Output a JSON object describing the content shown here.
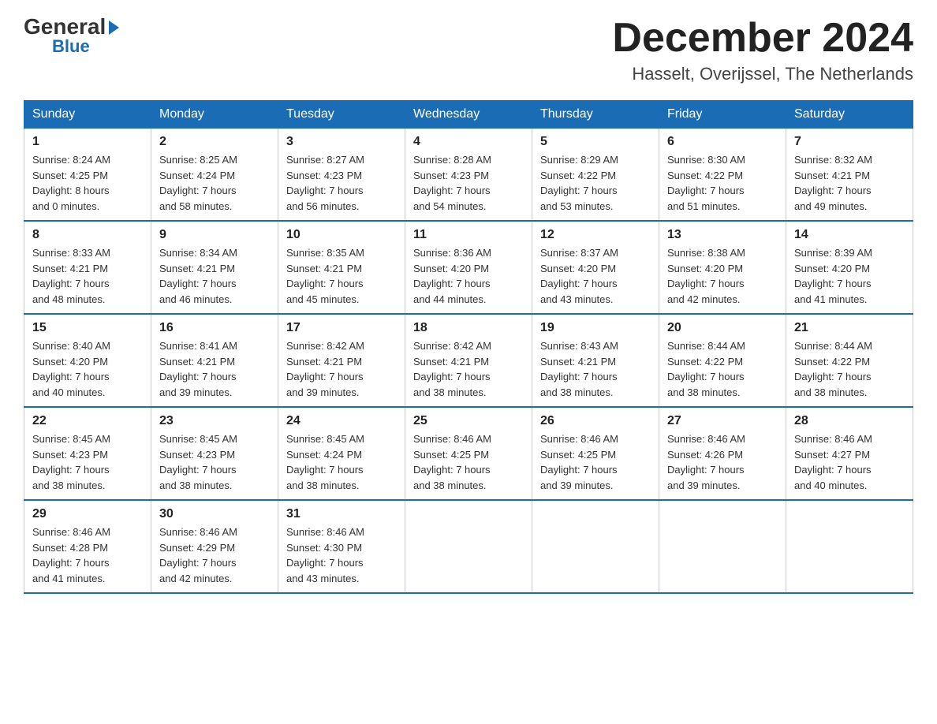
{
  "logo": {
    "general": "General",
    "arrow": "▶",
    "blue": "Blue"
  },
  "title": "December 2024",
  "location": "Hasselt, Overijssel, The Netherlands",
  "days_of_week": [
    "Sunday",
    "Monday",
    "Tuesday",
    "Wednesday",
    "Thursday",
    "Friday",
    "Saturday"
  ],
  "weeks": [
    [
      {
        "day": "1",
        "sunrise": "8:24 AM",
        "sunset": "4:25 PM",
        "daylight": "8 hours and 0 minutes."
      },
      {
        "day": "2",
        "sunrise": "8:25 AM",
        "sunset": "4:24 PM",
        "daylight": "7 hours and 58 minutes."
      },
      {
        "day": "3",
        "sunrise": "8:27 AM",
        "sunset": "4:23 PM",
        "daylight": "7 hours and 56 minutes."
      },
      {
        "day": "4",
        "sunrise": "8:28 AM",
        "sunset": "4:23 PM",
        "daylight": "7 hours and 54 minutes."
      },
      {
        "day": "5",
        "sunrise": "8:29 AM",
        "sunset": "4:22 PM",
        "daylight": "7 hours and 53 minutes."
      },
      {
        "day": "6",
        "sunrise": "8:30 AM",
        "sunset": "4:22 PM",
        "daylight": "7 hours and 51 minutes."
      },
      {
        "day": "7",
        "sunrise": "8:32 AM",
        "sunset": "4:21 PM",
        "daylight": "7 hours and 49 minutes."
      }
    ],
    [
      {
        "day": "8",
        "sunrise": "8:33 AM",
        "sunset": "4:21 PM",
        "daylight": "7 hours and 48 minutes."
      },
      {
        "day": "9",
        "sunrise": "8:34 AM",
        "sunset": "4:21 PM",
        "daylight": "7 hours and 46 minutes."
      },
      {
        "day": "10",
        "sunrise": "8:35 AM",
        "sunset": "4:21 PM",
        "daylight": "7 hours and 45 minutes."
      },
      {
        "day": "11",
        "sunrise": "8:36 AM",
        "sunset": "4:20 PM",
        "daylight": "7 hours and 44 minutes."
      },
      {
        "day": "12",
        "sunrise": "8:37 AM",
        "sunset": "4:20 PM",
        "daylight": "7 hours and 43 minutes."
      },
      {
        "day": "13",
        "sunrise": "8:38 AM",
        "sunset": "4:20 PM",
        "daylight": "7 hours and 42 minutes."
      },
      {
        "day": "14",
        "sunrise": "8:39 AM",
        "sunset": "4:20 PM",
        "daylight": "7 hours and 41 minutes."
      }
    ],
    [
      {
        "day": "15",
        "sunrise": "8:40 AM",
        "sunset": "4:20 PM",
        "daylight": "7 hours and 40 minutes."
      },
      {
        "day": "16",
        "sunrise": "8:41 AM",
        "sunset": "4:21 PM",
        "daylight": "7 hours and 39 minutes."
      },
      {
        "day": "17",
        "sunrise": "8:42 AM",
        "sunset": "4:21 PM",
        "daylight": "7 hours and 39 minutes."
      },
      {
        "day": "18",
        "sunrise": "8:42 AM",
        "sunset": "4:21 PM",
        "daylight": "7 hours and 38 minutes."
      },
      {
        "day": "19",
        "sunrise": "8:43 AM",
        "sunset": "4:21 PM",
        "daylight": "7 hours and 38 minutes."
      },
      {
        "day": "20",
        "sunrise": "8:44 AM",
        "sunset": "4:22 PM",
        "daylight": "7 hours and 38 minutes."
      },
      {
        "day": "21",
        "sunrise": "8:44 AM",
        "sunset": "4:22 PM",
        "daylight": "7 hours and 38 minutes."
      }
    ],
    [
      {
        "day": "22",
        "sunrise": "8:45 AM",
        "sunset": "4:23 PM",
        "daylight": "7 hours and 38 minutes."
      },
      {
        "day": "23",
        "sunrise": "8:45 AM",
        "sunset": "4:23 PM",
        "daylight": "7 hours and 38 minutes."
      },
      {
        "day": "24",
        "sunrise": "8:45 AM",
        "sunset": "4:24 PM",
        "daylight": "7 hours and 38 minutes."
      },
      {
        "day": "25",
        "sunrise": "8:46 AM",
        "sunset": "4:25 PM",
        "daylight": "7 hours and 38 minutes."
      },
      {
        "day": "26",
        "sunrise": "8:46 AM",
        "sunset": "4:25 PM",
        "daylight": "7 hours and 39 minutes."
      },
      {
        "day": "27",
        "sunrise": "8:46 AM",
        "sunset": "4:26 PM",
        "daylight": "7 hours and 39 minutes."
      },
      {
        "day": "28",
        "sunrise": "8:46 AM",
        "sunset": "4:27 PM",
        "daylight": "7 hours and 40 minutes."
      }
    ],
    [
      {
        "day": "29",
        "sunrise": "8:46 AM",
        "sunset": "4:28 PM",
        "daylight": "7 hours and 41 minutes."
      },
      {
        "day": "30",
        "sunrise": "8:46 AM",
        "sunset": "4:29 PM",
        "daylight": "7 hours and 42 minutes."
      },
      {
        "day": "31",
        "sunrise": "8:46 AM",
        "sunset": "4:30 PM",
        "daylight": "7 hours and 43 minutes."
      },
      null,
      null,
      null,
      null
    ]
  ]
}
